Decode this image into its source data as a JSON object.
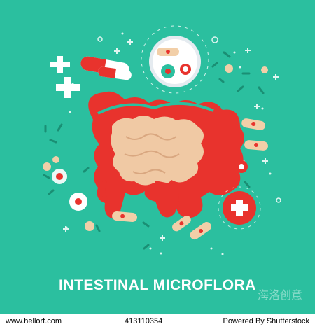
{
  "title": "INTESTINAL MICROFLORA",
  "watermark": "海洛创意",
  "footer": {
    "left": "www.hellorf.com",
    "mid": "413110354",
    "right": "Powered By Shutterstock"
  },
  "icons": [
    "intestine-icon",
    "capsule-icon",
    "medical-cross-icon",
    "bacteria-icon",
    "magnifier-icon"
  ],
  "colors": {
    "background": "#2bbf9f",
    "intestine": "#e8332d",
    "small-intestine": "#f0c9a4",
    "white": "#ffffff"
  }
}
